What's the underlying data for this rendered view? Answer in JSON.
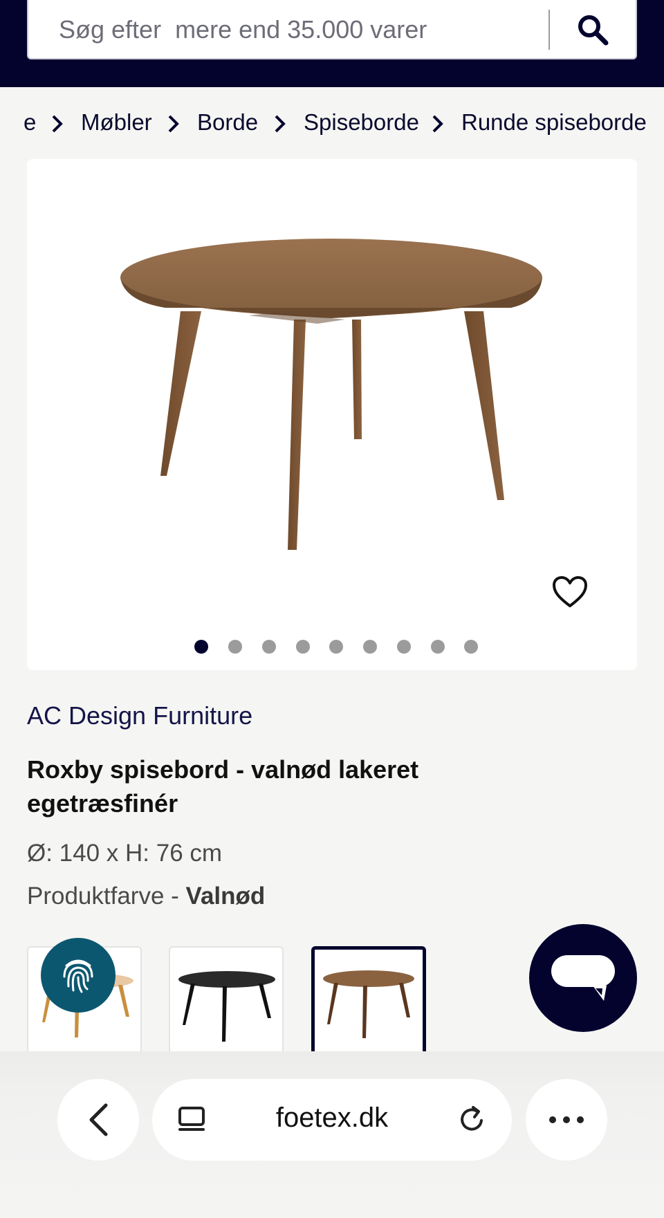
{
  "search": {
    "placeholder": "Søg efter  mere end 35.000 varer",
    "icon": "search-icon"
  },
  "breadcrumb": {
    "items": [
      "e",
      "Møbler",
      "Borde",
      "Spiseborde",
      "Runde spiseborde"
    ],
    "separator_icon": "chevron-right-icon"
  },
  "gallery": {
    "image": "Round walnut dining table",
    "favorite_icon": "heart-icon",
    "dot_count": 9,
    "active_dot": 1
  },
  "product": {
    "brand": "AC Design Furniture",
    "title": "Roxby spisebord - valnød lakeret egetræsfinér",
    "dimensions": "Ø: 140 x H: 76 cm",
    "color_label": "Produktfarve - ",
    "color_value": "Valnød"
  },
  "variants": [
    {
      "name": "light oak table",
      "selected": false
    },
    {
      "name": "black table",
      "selected": false
    },
    {
      "name": "walnut table",
      "selected": true
    }
  ],
  "floating": {
    "cookie_icon": "fingerprint-icon",
    "chat_icon": "chat-bubble-icon"
  },
  "browser": {
    "url": "foetex.dk",
    "back_icon": "chevron-left-icon",
    "tabs_icon": "tabs-icon",
    "reload_icon": "reload-icon",
    "more_icon": "more-dots-icon"
  },
  "colors": {
    "navy": "#03032e",
    "teal": "#0c5770",
    "background": "#f5f5f3",
    "walnut": "#8a6240"
  }
}
